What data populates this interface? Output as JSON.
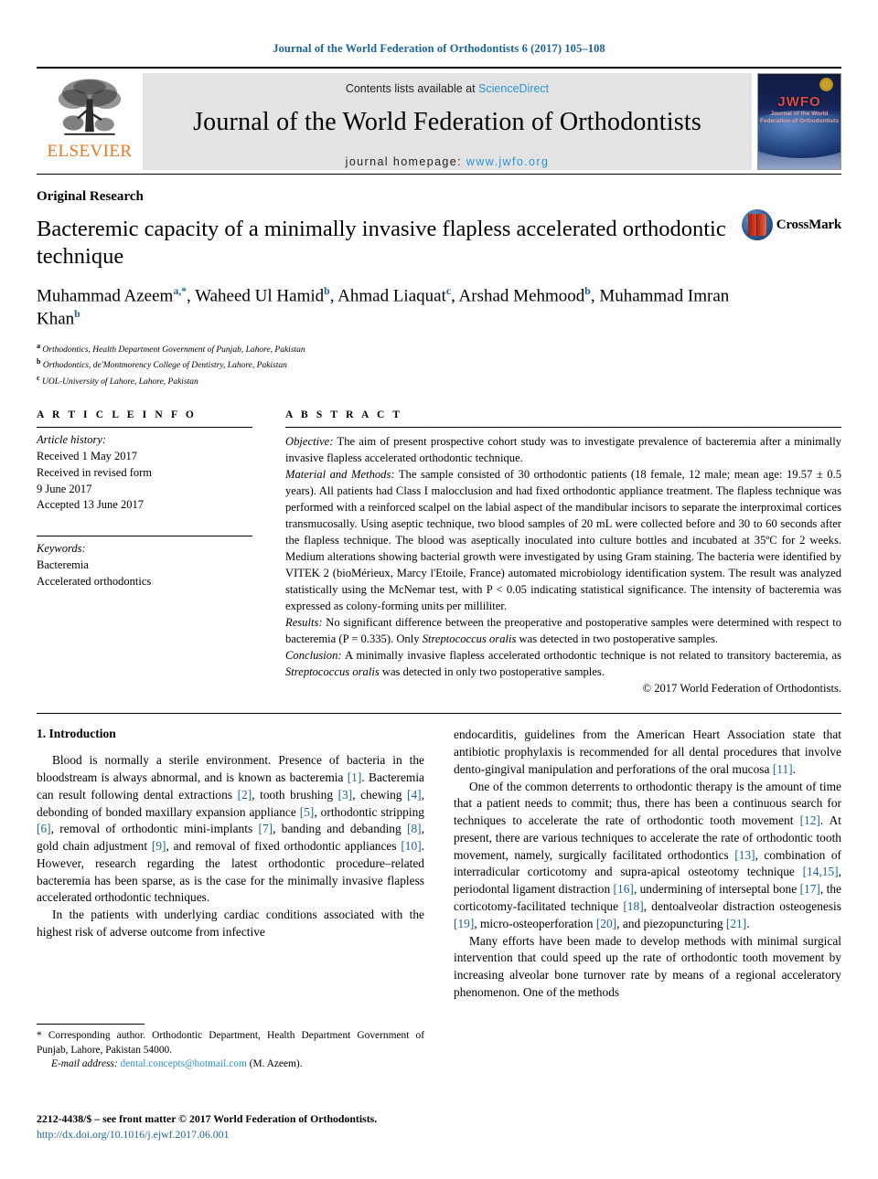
{
  "running_head": "Journal of the World Federation of Orthodontists 6 (2017) 105–108",
  "masthead": {
    "publisher_name": "ELSEVIER",
    "contents_prefix": "Contents lists available at ",
    "contents_link": "ScienceDirect",
    "journal_title": "Journal of the World Federation of Orthodontists",
    "homepage_prefix": "journal homepage: ",
    "homepage_link": "www.jwfo.org",
    "cover": {
      "acronym": "JWFO",
      "subtitle_line1": "Journal of the World",
      "subtitle_line2": "Federation of Orthodontists"
    },
    "link_color": "#2a93d4",
    "elsevier_orange": "#E87722"
  },
  "article": {
    "type": "Original Research",
    "title": "Bacteremic capacity of a minimally invasive flapless accelerated orthodontic technique",
    "authors_line1": "Muhammad Azeem",
    "authors_line1_sup": "a,*",
    "authors_rest": ", Waheed Ul Hamid ",
    "authors_full": "Muhammad Azeem a,*, Waheed Ul Hamid b, Ahmad Liaquat c, Arshad Mehmood b, Muhammad Imran Khan b",
    "affiliations": [
      {
        "mark": "a",
        "text": "Orthodontics, Health Department Government of Punjab, Lahore, Pakistan"
      },
      {
        "mark": "b",
        "text": "Orthodontics, de'Montmorency College of Dentistry, Lahore, Pakistan"
      },
      {
        "mark": "c",
        "text": "UOL-University of Lahore, Lahore, Pakistan"
      }
    ],
    "crossmark_label": "CrossMark"
  },
  "article_info": {
    "heading": "A R T I C L E   I N F O",
    "history_label": "Article history:",
    "history": [
      "Received 1 May 2017",
      "Received in revised form",
      "9 June 2017",
      "Accepted 13 June 2017"
    ],
    "keywords_label": "Keywords:",
    "keywords": [
      "Bacteremia",
      "Accelerated orthodontics"
    ]
  },
  "abstract": {
    "heading": "A B S T R A C T",
    "objective_label": "Objective:",
    "objective_text": " The aim of present prospective cohort study was to investigate prevalence of bacteremia after a minimally invasive flapless accelerated orthodontic technique.",
    "methods_label": "Material and Methods:",
    "methods_text": " The sample consisted of 30 orthodontic patients (18 female, 12 male; mean age: 19.57 ± 0.5 years). All patients had Class I malocclusion and had fixed orthodontic appliance treatment. The flapless technique was performed with a reinforced scalpel on the labial aspect of the mandibular incisors to separate the interproximal cortices transmucosally. Using aseptic technique, two blood samples of 20 mL were collected before and 30 to 60 seconds after the flapless technique. The blood was aseptically inoculated into culture bottles and incubated at 35ºC for 2 weeks. Medium alterations showing bacterial growth were investigated by using Gram staining. The bacteria were identified by VITEK 2 (bioMérieux, Marcy l'Etoile, France) automated microbiology identification system. The result was analyzed statistically using the McNemar test, with P < 0.05 indicating statistical significance. The intensity of bacteremia was expressed as colony-forming units per milliliter.",
    "results_label": "Results:",
    "results_text": " No significant difference between the preoperative and postoperative samples were determined with respect to bacteremia (P = 0.335). Only ",
    "results_organism": "Streptococcus oralis",
    "results_text2": " was detected in two postoperative samples.",
    "conclusion_label": "Conclusion:",
    "conclusion_text": " A minimally invasive flapless accelerated orthodontic technique is not related to transitory bacteremia, as ",
    "conclusion_organism": "Streptococcus oralis",
    "conclusion_text2": " was detected in only two postoperative samples.",
    "copyright": "© 2017 World Federation of Orthodontists."
  },
  "introduction": {
    "heading": "1. Introduction",
    "left_p1": "Blood is normally a sterile environment. Presence of bacteria in the bloodstream is always abnormal, and is known as bacteremia [1]. Bacteremia can result following dental extractions [2], tooth brushing [3], chewing [4], debonding of bonded maxillary expansion appliance [5], orthodontic stripping [6], removal of orthodontic mini-implants [7], banding and debanding [8], gold chain adjustment [9], and removal of fixed orthodontic appliances [10]. However, research regarding the latest orthodontic procedure–related bacteremia has been sparse, as is the case for the minimally invasive flapless accelerated orthodontic techniques.",
    "left_p2": "In the patients with underlying cardiac conditions associated with the highest risk of adverse outcome from infective",
    "right_p1": "endocarditis, guidelines from the American Heart Association state that antibiotic prophylaxis is recommended for all dental procedures that involve dento-gingival manipulation and perforations of the oral mucosa [11].",
    "right_p2": "One of the common deterrents to orthodontic therapy is the amount of time that a patient needs to commit; thus, there has been a continuous search for techniques to accelerate the rate of orthodontic tooth movement [12]. At present, there are various techniques to accelerate the rate of orthodontic tooth movement, namely, surgically facilitated orthodontics [13], combination of interradicular corticotomy and supra-apical osteotomy technique [14,15], periodontal ligament distraction [16], undermining of interseptal bone [17], the corticotomy-facilitated technique [18], dentoalveolar distraction osteogenesis [19], micro-osteoperforation [20], and piezopuncturing [21].",
    "right_p3": "Many efforts have been made to develop methods with minimal surgical intervention that could speed up the rate of orthodontic tooth movement by increasing alveolar bone turnover rate by means of a regional acceleratory phenomenon. One of the methods"
  },
  "footnotes": {
    "corresponding": "* Corresponding author. Orthodontic Department, Health Department Government of Punjab, Lahore, Pakistan 54000.",
    "email_label": "E-mail address:",
    "email": "dental.concepts@hotmail.com",
    "email_suffix": " (M. Azeem).",
    "issn_line": "2212-4438/$ – see front matter © 2017 World Federation of Orthodontists.",
    "doi": "http://dx.doi.org/10.1016/j.ejwf.2017.06.001"
  }
}
